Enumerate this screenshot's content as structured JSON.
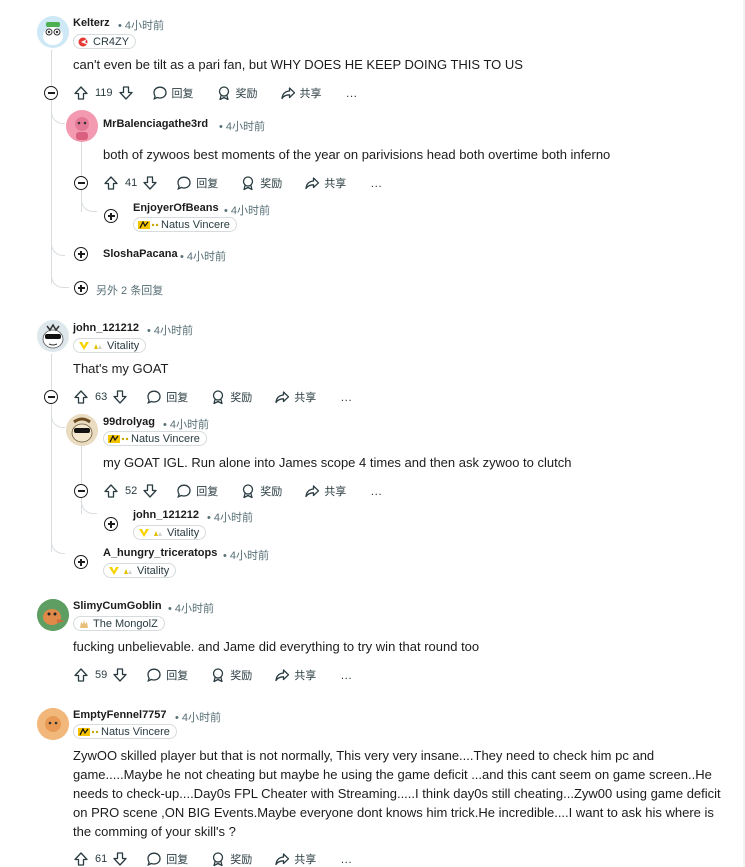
{
  "comments": [
    {
      "user": "Kelterz",
      "time": "• 4小时前",
      "flair": {
        "label": "CR4ZY",
        "icon": "cr4zy-logo-icon",
        "color": "#e53935"
      },
      "body": "can't even be tilt as a pari fan, but WHY DOES HE KEEP DOING THIS TO US",
      "votes": "119",
      "reply": "回复",
      "award": "奖励",
      "share": "共享",
      "more": "…",
      "replies": [
        {
          "user": "MrBalenciagathe3rd",
          "time": "• 4小时前",
          "body": "both of zywoos best moments of the year on parivisions head both overtime both inferno",
          "votes": "41",
          "reply": "回复",
          "award": "奖励",
          "share": "共享",
          "more": "…",
          "replies": [
            {
              "user": "EnjoyerOfBeans",
              "time": "• 4小时前",
              "flair": {
                "label": "Natus Vincere",
                "icon": "navi-logo-icon",
                "color": "#f5c400"
              }
            }
          ]
        },
        {
          "user": "SloshaPacana",
          "time": "• 4小时前"
        }
      ],
      "more_replies": "另外 2 条回复"
    },
    {
      "user": "john_121212",
      "time": "• 4小时前",
      "flair": {
        "label": "Vitality",
        "icon": "vitality-logo-icon",
        "color": "#f5d300"
      },
      "body": "That's my GOAT",
      "votes": "63",
      "reply": "回复",
      "award": "奖励",
      "share": "共享",
      "more": "…",
      "replies": [
        {
          "user": "99drolyag",
          "time": "• 4小时前",
          "flair": {
            "label": "Natus Vincere",
            "icon": "navi-logo-icon",
            "color": "#f5c400"
          },
          "body": "my GOAT IGL. Run alone into James scope 4 times and then ask zywoo to clutch",
          "votes": "52",
          "reply": "回复",
          "award": "奖励",
          "share": "共享",
          "more": "…",
          "replies": [
            {
              "user": "john_121212",
              "time": "• 4小时前",
              "flair": {
                "label": "Vitality",
                "icon": "vitality-logo-icon",
                "color": "#f5d300"
              }
            }
          ]
        },
        {
          "user": "A_hungry_triceratops",
          "time": "• 4小时前",
          "flair": {
            "label": "Vitality",
            "icon": "vitality-logo-icon",
            "color": "#f5d300"
          }
        }
      ]
    },
    {
      "user": "SlimyCumGoblin",
      "time": "• 4小时前",
      "flair": {
        "label": "The MongolZ",
        "icon": "mongolz-logo-icon",
        "color": "#e8c07a"
      },
      "body": "fucking unbelievable. and Jame did everything to try win that round too",
      "votes": "59",
      "reply": "回复",
      "award": "奖励",
      "share": "共享",
      "more": "…"
    },
    {
      "user": "EmptyFennel7757",
      "time": "• 4小时前",
      "flair": {
        "label": "Natus Vincere",
        "icon": "navi-logo-icon",
        "color": "#f5c400"
      },
      "body_lines": [
        "ZywOO skilled player but that is not normally, This very very insane....They need to check him pc and",
        "game.....Maybe he not cheating but maybe he using the game deficit ...and this cant seem on game screen..He",
        "needs to check-up....Day0s FPL Cheater with Streaming.....I think day0s still cheating...Zyw00 using game deficit",
        "on PRO scene ,ON BIG Events.Maybe everyone dont knows him trick.He incredible....I want to ask his where is",
        "the comming of your skill's ?"
      ],
      "votes": "61",
      "reply": "回复",
      "award": "奖励",
      "share": "共享",
      "more": "…"
    }
  ]
}
